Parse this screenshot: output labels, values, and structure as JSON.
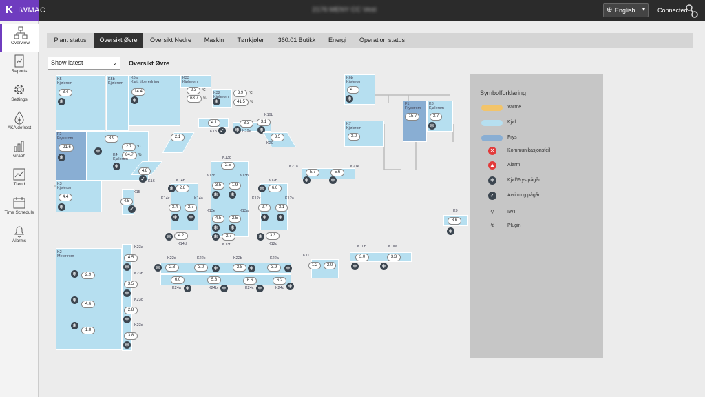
{
  "app": {
    "brand": "IWMAC",
    "title": "2176 MENY CC Vest",
    "language": "English",
    "connection": "Connected"
  },
  "nav": [
    {
      "label": "Overview"
    },
    {
      "label": "Reports"
    },
    {
      "label": "Settings"
    },
    {
      "label": "AKA defrost"
    },
    {
      "label": "Graph"
    },
    {
      "label": "Trend"
    },
    {
      "label": "Time Schedule"
    },
    {
      "label": "Alarms"
    }
  ],
  "tabs": [
    "Plant status",
    "Oversikt Øvre",
    "Oversikt Nedre",
    "Maskin",
    "Tørrkjøler",
    "360.01 Butikk",
    "Energi",
    "Operation status"
  ],
  "toolbar": {
    "select_value": "Show latest",
    "view_title": "Oversikt Øvre"
  },
  "rooms": {
    "k5": {
      "id": "K5",
      "name": "Kjølerom",
      "value": "3.4"
    },
    "k5b": {
      "id": "K5b",
      "name": "Kjølerom"
    },
    "k6a": {
      "id": "K6a",
      "name": "Kjøtt tilberedning",
      "value": "14.4"
    },
    "k33": {
      "id": "K33",
      "name": "Kjølerom",
      "temp": "2.3",
      "hum": "68.7"
    },
    "k32": {
      "id": "K32",
      "name": "Kjølerom",
      "temp": "3.9",
      "hum": "41.5"
    },
    "k6b": {
      "id": "K6b",
      "name": "Kjølerom",
      "value": "4.1"
    },
    "f1": {
      "id": "F1",
      "name": "Fryserom",
      "value": "-15.7"
    },
    "k8": {
      "id": "K8",
      "name": "Kjølerom",
      "value": "3.7"
    },
    "k7": {
      "id": "K7",
      "name": "Kjølerom",
      "value": "3.0"
    },
    "f2": {
      "id": "F2",
      "name": "Fryserom",
      "value": "-21.6"
    },
    "k4": {
      "id": "K4",
      "name": "Kjølerom",
      "temp": "2.7",
      "hum": "84.7"
    },
    "k4b": {
      "value": "3.9"
    },
    "k3": {
      "id": "K3",
      "name": "Kjølerom",
      "value": "4.4"
    },
    "k2": {
      "id": "K2",
      "name": "Meierirom",
      "v1": "2.9",
      "v2": "4.6",
      "v3": "1.8"
    },
    "k18": {
      "id": "K18",
      "value": "4.1"
    },
    "k19a": {
      "id": "K19a",
      "value": "3.3"
    },
    "k19b": {
      "id": "K19b",
      "value": "3.1"
    },
    "k20": {
      "id": "K20",
      "value": "3.5"
    },
    "k17": {
      "value": "2.1"
    },
    "k16": {
      "id": "K16",
      "value": "4.8"
    },
    "k15": {
      "id": "K15",
      "value": "4.5"
    },
    "k13c": {
      "id": "K13c",
      "value": "2.5"
    },
    "k13d": {
      "id": "K13d",
      "value": "3.5"
    },
    "k13b": {
      "id": "K13b",
      "value": "1.9"
    },
    "k13e": {
      "id": "K13e",
      "value": "4.5"
    },
    "k13a": {
      "id": "K13a",
      "value": "2.5"
    },
    "k13f": {
      "id": "K13f",
      "value": "2.7"
    },
    "k14b": {
      "id": "K14b",
      "value": "2.8"
    },
    "k14c": {
      "id": "K14c",
      "value": "3.4"
    },
    "k14a": {
      "id": "K14a",
      "value": "2.7"
    },
    "k14d": {
      "id": "K14d",
      "value": "4.2"
    },
    "k12b": {
      "id": "K12b",
      "value": "6.6"
    },
    "k12c": {
      "id": "K12c",
      "value": "2.7"
    },
    "k12a": {
      "id": "K12a",
      "value": "3.1"
    },
    "k12d": {
      "id": "K12d",
      "value": "3.3"
    },
    "k21a": {
      "id": "K21a",
      "value": "5.7"
    },
    "k21e": {
      "id": "K21e",
      "value": "5.6"
    },
    "k9": {
      "id": "K9",
      "value": "3.6"
    },
    "k23a": {
      "id": "K23a",
      "value": "4.5"
    },
    "k23b": {
      "id": "K23b",
      "value": "3.5"
    },
    "k23c": {
      "id": "K23c",
      "value": "2.8"
    },
    "k23d": {
      "id": "K23d",
      "value": "3.8"
    },
    "k22d": {
      "id": "K22d",
      "value": "2.8"
    },
    "k22c": {
      "id": "K22c",
      "value": "3.0"
    },
    "k22b": {
      "id": "K22b",
      "value": "2.8"
    },
    "k22a": {
      "id": "K22a",
      "value": "3.9"
    },
    "k24a": {
      "id": "K24a",
      "value": "6.0"
    },
    "k24b": {
      "id": "K24b",
      "value": "5.8"
    },
    "k24c": {
      "id": "K24c",
      "value": "6.6"
    },
    "k24d": {
      "id": "K24d",
      "value": "6.2"
    },
    "k11": {
      "id": "K11",
      "v1": "1.2",
      "v2": "2.0"
    },
    "k10b": {
      "id": "K10b",
      "value": "3.0"
    },
    "k10a": {
      "id": "K10a",
      "value": "3.3"
    }
  },
  "units": {
    "celsius": "°C",
    "percent": "%"
  },
  "legend": {
    "title": "Symbolforklaring",
    "items": [
      {
        "label": "Varme",
        "color": "#f2c46a"
      },
      {
        "label": "Kjøl",
        "color": "#b6dff0"
      },
      {
        "label": "Frys",
        "color": "#89aed3"
      },
      {
        "label": "Kommunikasjonsfeil",
        "icon": "comm-error-icon"
      },
      {
        "label": "Alarm",
        "icon": "alarm-icon"
      },
      {
        "label": "Kjøl/Frys pågår",
        "icon": "snowflake-icon"
      },
      {
        "label": "Avriming pågår",
        "icon": "defrost-icon"
      },
      {
        "label": "IWT",
        "icon": "iwt-icon"
      },
      {
        "label": "Plugin",
        "icon": "plugin-icon"
      }
    ]
  }
}
